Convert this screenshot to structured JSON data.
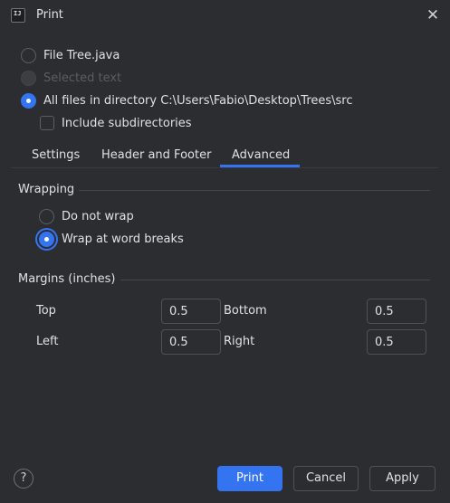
{
  "window": {
    "title": "Print",
    "app_icon_text": "IJ"
  },
  "scope": {
    "options": [
      {
        "label": "File Tree.java",
        "checked": false,
        "disabled": false
      },
      {
        "label": "Selected text",
        "checked": false,
        "disabled": true
      },
      {
        "label": "All files in directory C:\\Users\\Fabio\\Desktop\\Trees\\src",
        "checked": true,
        "disabled": false
      }
    ],
    "include_subdirectories": {
      "label": "Include subdirectories",
      "checked": false
    }
  },
  "tabs": [
    {
      "label": "Settings",
      "selected": false
    },
    {
      "label": "Header and Footer",
      "selected": false
    },
    {
      "label": "Advanced",
      "selected": true
    }
  ],
  "wrapping": {
    "title": "Wrapping",
    "options": [
      {
        "label": "Do not wrap",
        "checked": false
      },
      {
        "label": "Wrap at word breaks",
        "checked": true
      }
    ]
  },
  "margins": {
    "title": "Margins (inches)",
    "top": {
      "label": "Top",
      "value": "0.5"
    },
    "bottom": {
      "label": "Bottom",
      "value": "0.5"
    },
    "left": {
      "label": "Left",
      "value": "0.5"
    },
    "right": {
      "label": "Right",
      "value": "0.5"
    }
  },
  "footer": {
    "help_label": "?",
    "print_label": "Print",
    "cancel_label": "Cancel",
    "apply_label": "Apply"
  },
  "colors": {
    "background": "#2b2d30",
    "accent": "#3574f0",
    "text": "#dfe1e5",
    "disabled_text": "#5a5d63"
  },
  "icons": {
    "close": "close-icon",
    "app": "intellij-app-icon",
    "help": "help-icon"
  }
}
